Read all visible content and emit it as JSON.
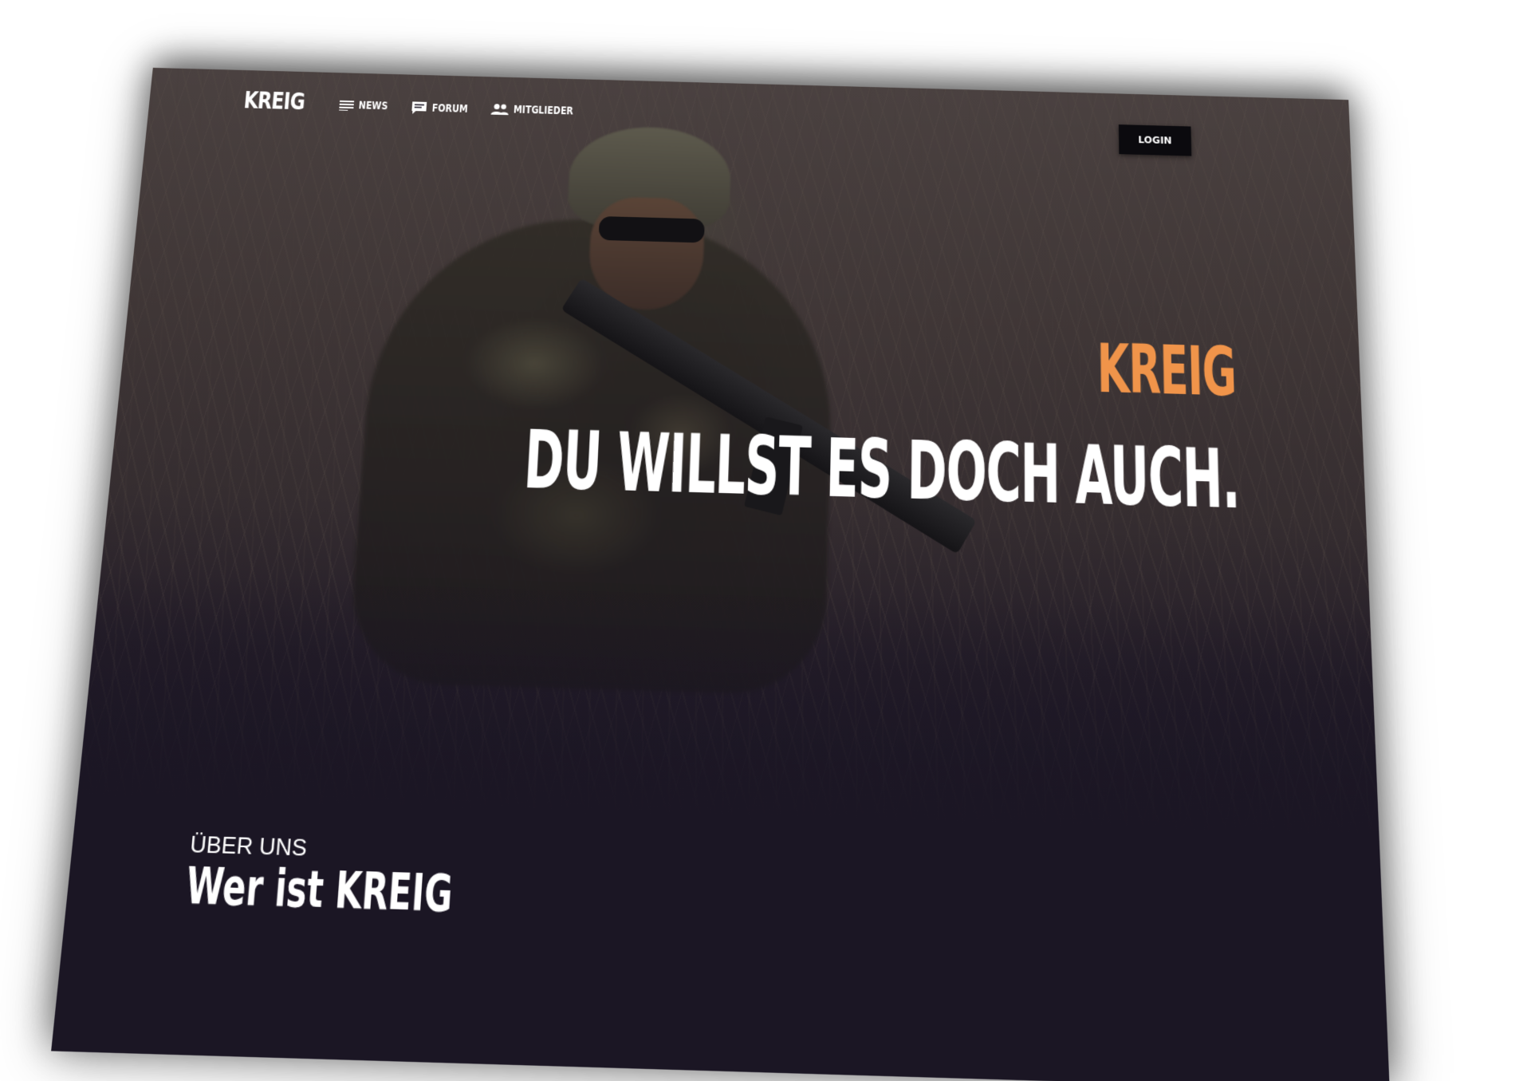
{
  "nav": {
    "brand": "KREIG",
    "items": [
      {
        "label": "NEWS",
        "icon": "news-lines-icon"
      },
      {
        "label": "FORUM",
        "icon": "chat-bubble-icon"
      },
      {
        "label": "MITGLIEDER",
        "icon": "members-icon"
      }
    ],
    "login_label": "LOGIN"
  },
  "hero": {
    "kicker": "KREIG",
    "headline": "DU WILLST ES DOCH AUCH."
  },
  "about": {
    "eyebrow": "ÜBER UNS",
    "title": "Wer ist KREIG"
  },
  "colors": {
    "accent": "#f0944a",
    "background": "#1b1624",
    "text": "#ffffff",
    "button": "#0b0a0e"
  }
}
